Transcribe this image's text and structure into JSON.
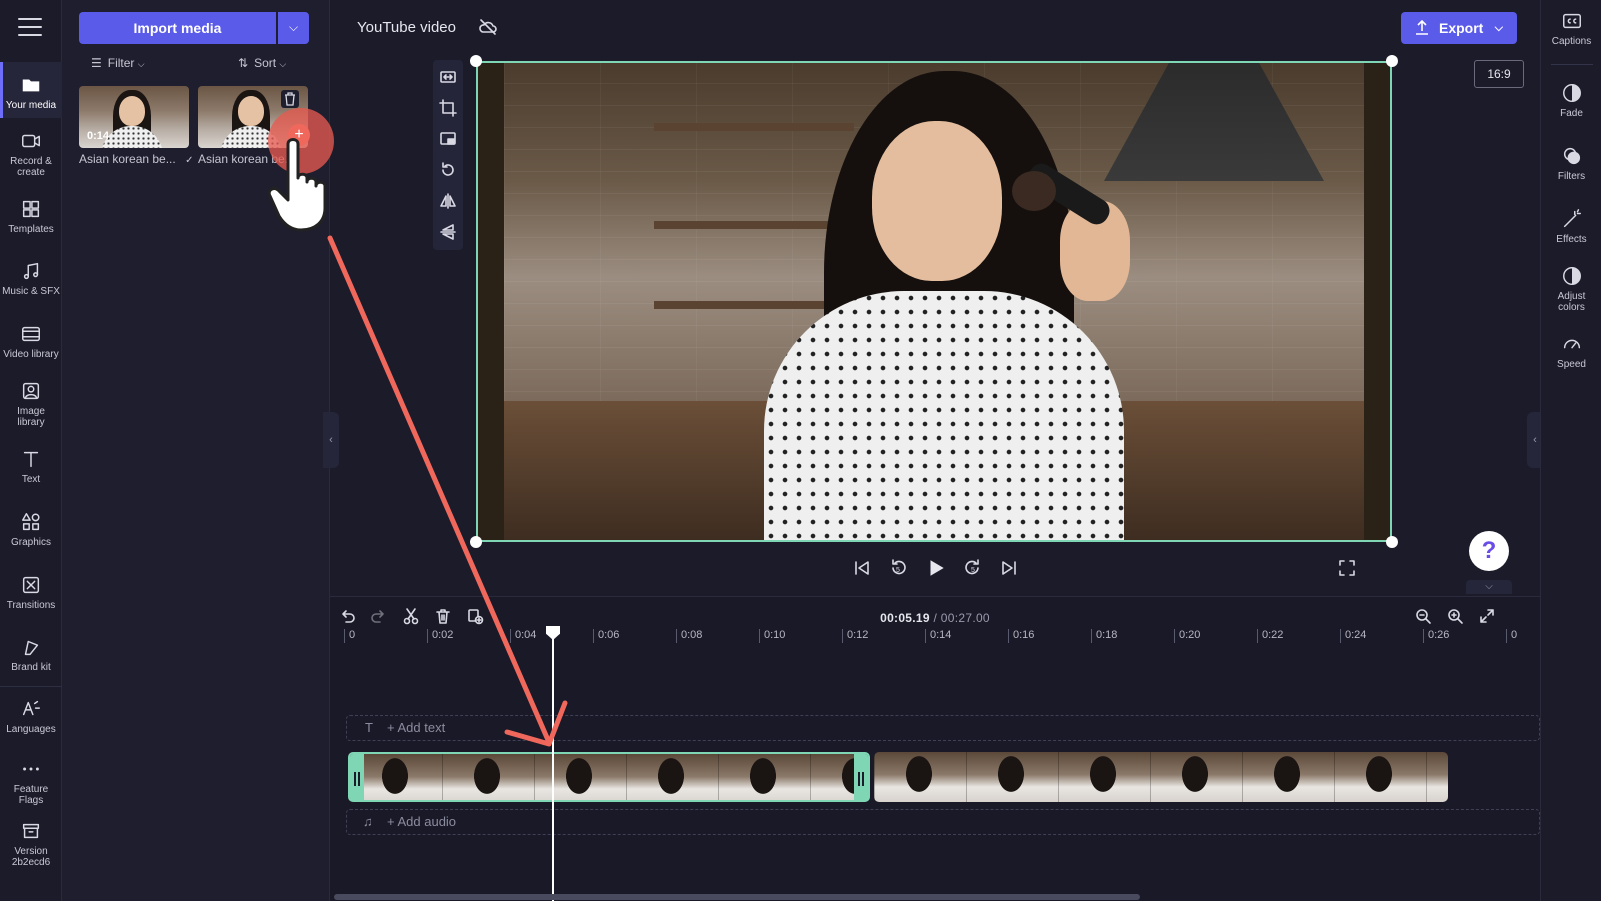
{
  "left_nav": {
    "items": [
      {
        "label": "Your media",
        "icon": "folder-icon"
      },
      {
        "label": "Record & create",
        "icon": "camera-icon"
      },
      {
        "label": "Templates",
        "icon": "templates-icon"
      },
      {
        "label": "Music & SFX",
        "icon": "music-note-icon"
      },
      {
        "label": "Video library",
        "icon": "film-icon"
      },
      {
        "label": "Image library",
        "icon": "image-icon"
      },
      {
        "label": "Text",
        "icon": "text-icon"
      },
      {
        "label": "Graphics",
        "icon": "shapes-icon"
      },
      {
        "label": "Transitions",
        "icon": "transition-icon"
      },
      {
        "label": "Brand kit",
        "icon": "brand-kit-icon"
      },
      {
        "label": "Languages",
        "icon": "language-icon"
      },
      {
        "label": "Feature Flags",
        "icon": "more-dots-icon"
      },
      {
        "label": "Version 2b2ecd6",
        "icon": "archive-box-icon"
      }
    ]
  },
  "media": {
    "import_label": "Import media",
    "filter_label": "Filter",
    "sort_label": "Sort",
    "items": [
      {
        "name": "Asian korean be...",
        "duration": "0:14"
      },
      {
        "name": "Asian korean be..."
      }
    ]
  },
  "header": {
    "project_title": "YouTube video",
    "export_label": "Export",
    "aspect_ratio": "16:9"
  },
  "right_nav": {
    "items": [
      {
        "label": "Captions",
        "icon": "captions-icon"
      },
      {
        "label": "Fade",
        "icon": "fade-icon"
      },
      {
        "label": "Filters",
        "icon": "filters-icon"
      },
      {
        "label": "Effects",
        "icon": "magic-wand-icon"
      },
      {
        "label": "Adjust colors",
        "icon": "contrast-icon"
      },
      {
        "label": "Speed",
        "icon": "speedometer-icon"
      }
    ]
  },
  "timeline": {
    "current_time": "00:05.19",
    "total_time": "/ 00:27.00",
    "ruler_ticks": [
      "0",
      "0:02",
      "0:04",
      "0:06",
      "0:08",
      "0:10",
      "0:12",
      "0:14",
      "0:16",
      "0:18",
      "0:20",
      "0:22",
      "0:24",
      "0:26",
      "0"
    ],
    "add_text_label": "+ Add text",
    "add_audio_label": "+ Add audio"
  },
  "help": {
    "label": "?"
  },
  "colors": {
    "accent": "#5b5bea",
    "selection": "#7fd6b4",
    "drag_arrow": "#f0685c"
  }
}
